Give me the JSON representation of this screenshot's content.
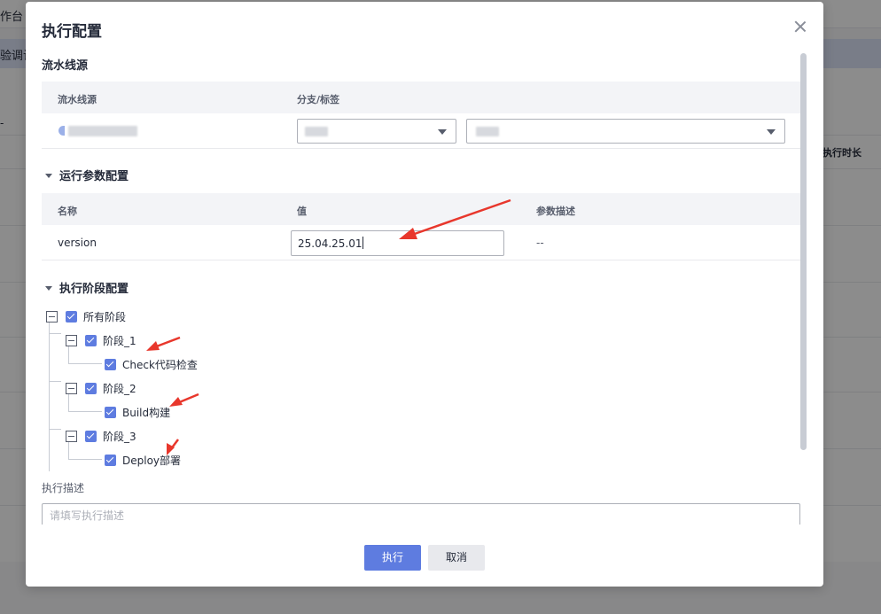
{
  "background": {
    "top_nav_text": "作台",
    "highlight_row_text": "验调试",
    "dash_text": "-",
    "column_header": "执行时长"
  },
  "modal": {
    "title": "执行配置",
    "pipeline_source": {
      "section_title": "流水线源",
      "col_source": "流水线源",
      "col_branch": "分支/标签"
    },
    "run_params": {
      "section_title": "运行参数配置",
      "col_name": "名称",
      "col_value": "值",
      "col_desc": "参数描述",
      "rows": [
        {
          "name": "version",
          "value": "25.04.25.01",
          "desc": "--"
        }
      ]
    },
    "stages": {
      "section_title": "执行阶段配置",
      "root_label": "所有阶段",
      "items": [
        {
          "label": "阶段_1",
          "job": "Check代码检查"
        },
        {
          "label": "阶段_2",
          "job": "Build构建"
        },
        {
          "label": "阶段_3",
          "job": "Deploy部署"
        }
      ]
    },
    "description": {
      "label": "执行描述",
      "placeholder": "请填写执行描述"
    },
    "buttons": {
      "run": "执行",
      "cancel": "取消"
    }
  },
  "colors": {
    "primary": "#5e7ce0",
    "annotation_arrow": "#e8372c"
  }
}
